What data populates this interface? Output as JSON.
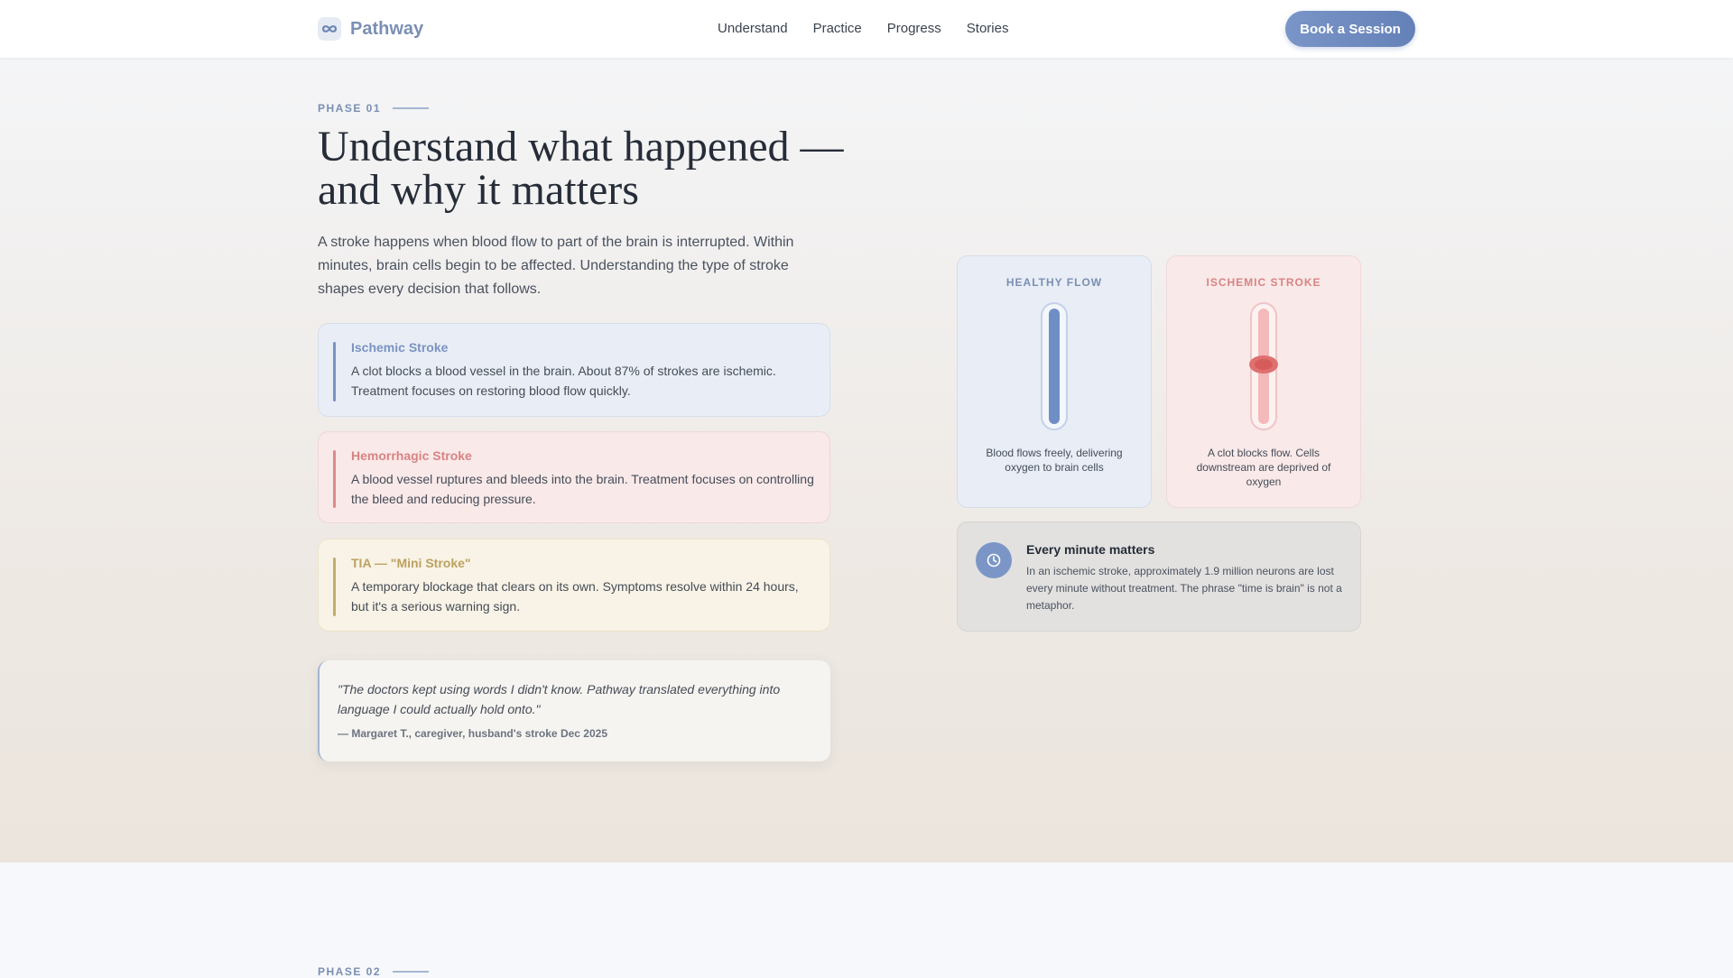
{
  "brand": {
    "name": "Pathway",
    "icon": "infinity-logo-icon"
  },
  "nav": {
    "items": [
      "Understand",
      "Practice",
      "Progress",
      "Stories"
    ]
  },
  "header": {
    "cta_label": "Book a Session"
  },
  "hero": {
    "phase_label": "PHASE 01",
    "headline": "Understand what happened — and why it matters",
    "lead": "A stroke happens when blood flow to part of the brain is interrupted. Within minutes, brain cells begin to be affected. Understanding the type of stroke shapes every decision that follows.",
    "types": [
      {
        "title": "Ischemic Stroke",
        "description": "A clot blocks a blood vessel in the brain. About 87% of strokes are ischemic. Treatment focuses on restoring blood flow quickly.",
        "accent": "#7a93c2"
      },
      {
        "title": "Hemorrhagic Stroke",
        "description": "A blood vessel ruptures and bleeds into the brain. Treatment focuses on controlling the bleed and reducing pressure.",
        "accent": "#d98383"
      },
      {
        "title": "TIA — \"Mini Stroke\"",
        "description": "A temporary blockage that clears on its own. Symptoms resolve within 24 hours, but it's a serious warning sign.",
        "accent": "#bda25f"
      }
    ],
    "testimonial": {
      "quote": "\"The doctors kept using words I didn't know. Pathway translated everything into language I could actually hold onto.\"",
      "attribution": "— Margaret T., caregiver, husband's stroke Dec 2025"
    }
  },
  "illustration": {
    "healthy": {
      "title": "HEALTHY FLOW",
      "caption": "Blood flows freely, delivering oxygen to brain cells",
      "color": "#6f8ec6"
    },
    "ischemic": {
      "title": "ISCHEMIC STROKE",
      "caption": "A clot blocks flow. Cells downstream are deprived of oxygen",
      "color": "#e07070"
    }
  },
  "info": {
    "icon": "clock-icon",
    "title": "Every minute matters",
    "body": "In an ischemic stroke, approximately 1.9 million neurons are lost every minute without treatment. The phrase \"time is brain\" is not a metaphor."
  },
  "next_section": {
    "phase_label": "PHASE 02"
  }
}
